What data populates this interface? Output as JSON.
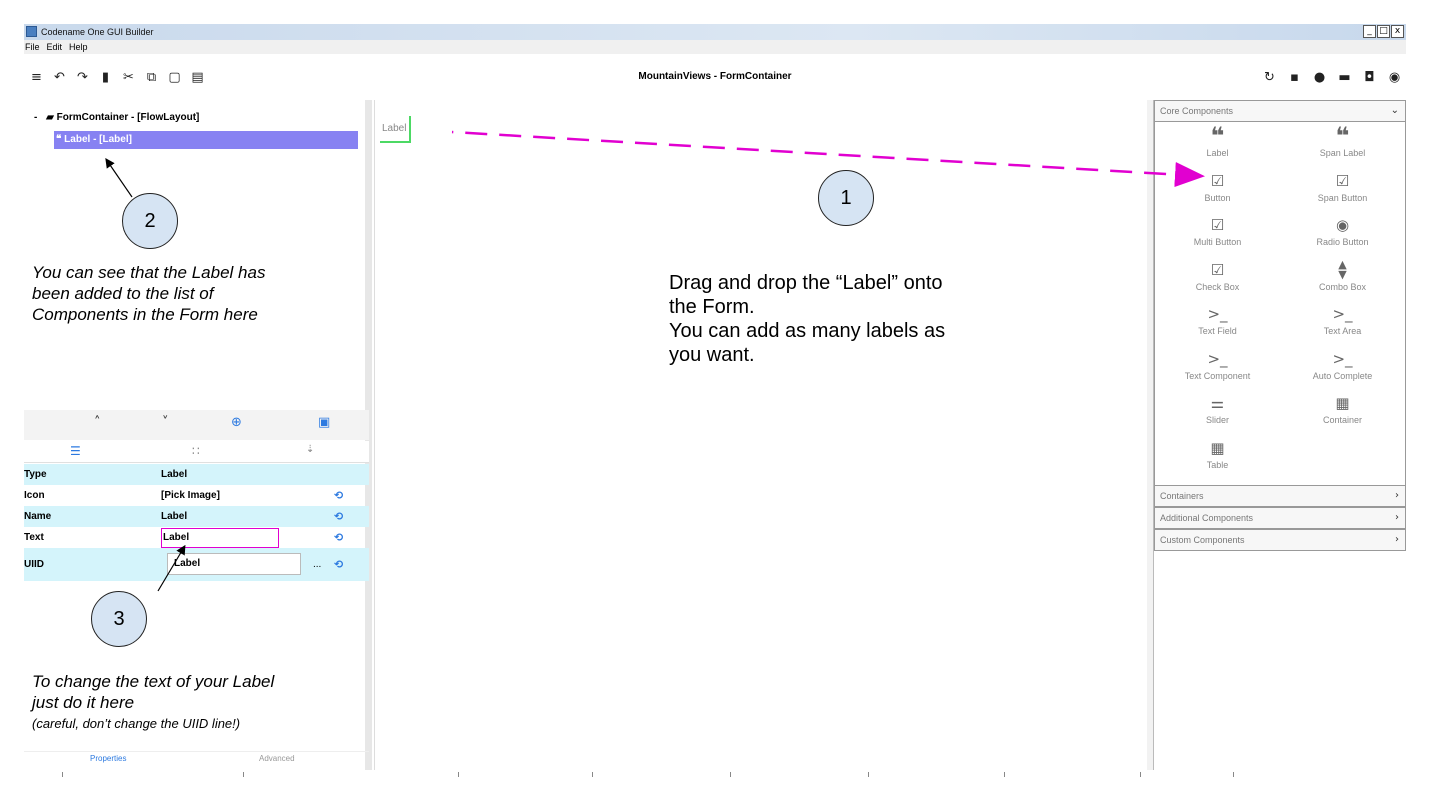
{
  "window": {
    "title": "Codename One GUI Builder",
    "controls": [
      "_",
      "□",
      "x"
    ]
  },
  "menu": [
    "File",
    "Edit",
    "Help"
  ],
  "toolbar": {
    "form_title": "MountainViews - FormContainer",
    "left_icons": [
      "menu-icon",
      "undo-icon",
      "redo-icon",
      "delete-icon",
      "cut-icon",
      "copy-icon",
      "paste-icon",
      "list-icon"
    ],
    "right_icons": [
      "refresh-icon",
      "save-icon",
      "preview-icon",
      "export-icon",
      "save-all-icon",
      "run-icon"
    ]
  },
  "tree": {
    "root_toggle": "-",
    "root": "FormContainer - [FlowLayout]",
    "child": "Label - [Label]"
  },
  "properties": {
    "rows": [
      {
        "name": "Type",
        "value": "Label"
      },
      {
        "name": "Icon",
        "value": "[Pick Image]"
      },
      {
        "name": "Name",
        "value": "Label"
      },
      {
        "name": "Text",
        "value": "Label"
      },
      {
        "name": "UIID",
        "value": "Label",
        "dots": "..."
      }
    ],
    "bottom_tabs": [
      "Properties",
      "Advanced"
    ]
  },
  "canvas": {
    "label": "Label"
  },
  "palette": {
    "sections": [
      {
        "title": "Core Components",
        "chevron": "⌄"
      },
      {
        "title": "Containers",
        "chevron": "›"
      },
      {
        "title": "Additional Components",
        "chevron": "›"
      },
      {
        "title": "Custom Components",
        "chevron": "›"
      }
    ],
    "items": [
      {
        "label": "Label",
        "icon": "quote-icon"
      },
      {
        "label": "Span Label",
        "icon": "quote-icon"
      },
      {
        "label": "Button",
        "icon": "checkbox-icon"
      },
      {
        "label": "Span Button",
        "icon": "checkbox-icon"
      },
      {
        "label": "Multi Button",
        "icon": "checkbox-icon"
      },
      {
        "label": "Radio Button",
        "icon": "radio-icon"
      },
      {
        "label": "Check Box",
        "icon": "check-square-icon"
      },
      {
        "label": "Combo Box",
        "icon": "sort-icon"
      },
      {
        "label": "Text Field",
        "icon": "terminal-icon"
      },
      {
        "label": "Text Area",
        "icon": "terminal-icon"
      },
      {
        "label": "Text Component",
        "icon": "terminal-icon"
      },
      {
        "label": "Auto Complete",
        "icon": "terminal-icon"
      },
      {
        "label": "Slider",
        "icon": "slider-icon"
      },
      {
        "label": "Container",
        "icon": "grid-icon"
      },
      {
        "label": "Table",
        "icon": "table-icon"
      }
    ]
  },
  "annotations": {
    "c1": "1",
    "c2": "2",
    "c3": "3",
    "note2": [
      "You can see that the Label has",
      "been added to the list of",
      "Components in the Form here"
    ],
    "note1": [
      "Drag and drop the “Label” onto",
      "the Form.",
      "You can add as many labels as",
      "you want."
    ],
    "note3": [
      "To change the text of your Label",
      "just do it here"
    ],
    "note3_small": "(careful, don’t change the UIID line!)"
  },
  "colors": {
    "selection": "#8782f2",
    "arrow": "#e100d0",
    "accent": "#2d7ae0",
    "drop_indicator": "#4cd964",
    "callout_fill": "#d6e4f3",
    "row_highlight": "#d4f4fb"
  }
}
